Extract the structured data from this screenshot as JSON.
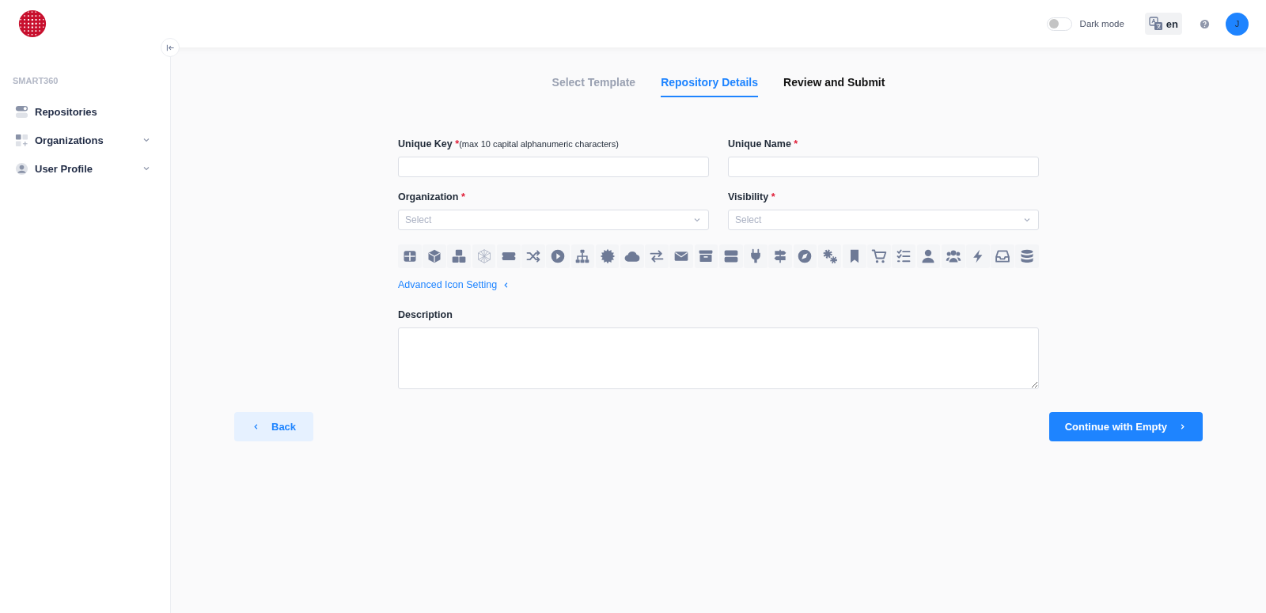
{
  "header": {
    "dark_mode": {
      "label": "Dark mode",
      "on": false
    },
    "language": {
      "label": "en"
    },
    "avatar": {
      "initial": "J"
    }
  },
  "sidebar": {
    "section_title": "SMART360",
    "items": [
      {
        "label": "Repositories",
        "kind": "link",
        "selected": false
      },
      {
        "label": "Organizations",
        "kind": "group",
        "selected": false,
        "expanded": false
      },
      {
        "label": "User Profile",
        "kind": "group",
        "selected": false,
        "expanded": false
      }
    ]
  },
  "steps": [
    {
      "label": "Select Template",
      "selected": false,
      "completed": true
    },
    {
      "label": "Repository Details",
      "selected": true,
      "completed": false
    },
    {
      "label": "Review and Submit",
      "selected": false,
      "completed": false
    }
  ],
  "form": {
    "fields": [
      {
        "kind": "text",
        "label": "Unique Key",
        "required_mark": "*",
        "hint": "(max 10 capital alphanumeric characters)"
      },
      {
        "kind": "text",
        "label": "Unique Name",
        "required_mark": "*"
      },
      {
        "kind": "select",
        "label": "Organization",
        "required_mark": "*",
        "placeholder": "Select"
      },
      {
        "kind": "select",
        "label": "Visibility",
        "required_mark": "*",
        "placeholder": "Select"
      }
    ],
    "icons": [
      {
        "kind": "table",
        "selected": false
      },
      {
        "kind": "cube",
        "selected": false
      },
      {
        "kind": "cubes",
        "selected": false
      },
      {
        "kind": "hexagon",
        "selected": false
      },
      {
        "kind": "ticket",
        "selected": false
      },
      {
        "kind": "shuffle",
        "selected": false
      },
      {
        "kind": "play",
        "selected": false
      },
      {
        "kind": "sitemap",
        "selected": false
      },
      {
        "kind": "badge",
        "selected": false
      },
      {
        "kind": "cloud",
        "selected": false
      },
      {
        "kind": "exchange",
        "selected": false
      },
      {
        "kind": "envelope",
        "selected": false
      },
      {
        "kind": "archive",
        "selected": false
      },
      {
        "kind": "server",
        "selected": false
      },
      {
        "kind": "plug",
        "selected": false
      },
      {
        "kind": "signpost",
        "selected": false
      },
      {
        "kind": "compass",
        "selected": false
      },
      {
        "kind": "gears",
        "selected": false
      },
      {
        "kind": "bookmark",
        "selected": false
      },
      {
        "kind": "cart",
        "selected": false
      },
      {
        "kind": "checklist",
        "selected": false
      },
      {
        "kind": "user",
        "selected": false
      },
      {
        "kind": "users",
        "selected": false
      },
      {
        "kind": "bolt",
        "selected": false
      },
      {
        "kind": "inbox",
        "selected": false
      },
      {
        "kind": "database",
        "selected": false
      }
    ],
    "advanced_link": {
      "label": "Advanced Icon Setting",
      "expanded": false
    },
    "description": {
      "label": "Description"
    }
  },
  "buttons": {
    "back": "Back",
    "continue": "Continue with Empty"
  }
}
